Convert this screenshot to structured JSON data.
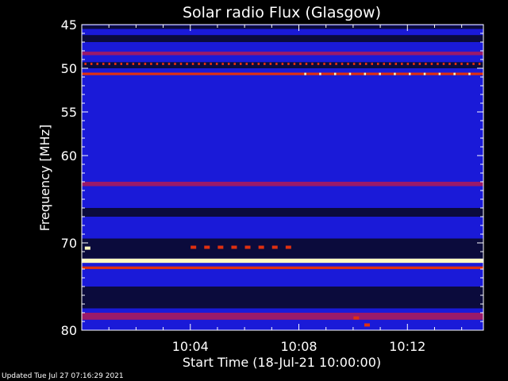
{
  "chart_data": {
    "type": "heatmap",
    "title": "Solar radio Flux (Glasgow)",
    "xlabel": "Start Time (18-Jul-21 10:00:00)",
    "ylabel": "Frequency [MHz]",
    "xlim_minutes": [
      0,
      14.8
    ],
    "ylim_mhz": [
      45,
      80
    ],
    "y_ticks": [
      {
        "value": 45,
        "label": "45"
      },
      {
        "value": 50,
        "label": "50"
      },
      {
        "value": 55,
        "label": "55"
      },
      {
        "value": 60,
        "label": "60"
      },
      {
        "value": 70,
        "label": "70"
      },
      {
        "value": 80,
        "label": "80"
      }
    ],
    "y_minor_ticks": [
      46,
      47,
      48,
      49,
      51,
      52,
      53,
      54,
      56,
      57,
      58,
      59,
      61,
      62,
      63,
      64,
      65,
      66,
      67,
      68,
      69,
      71,
      72,
      73,
      74,
      75,
      76,
      77,
      78,
      79
    ],
    "x_ticks": [
      {
        "value": 4,
        "label": "10:04"
      },
      {
        "value": 8,
        "label": "10:08"
      },
      {
        "value": 12,
        "label": "10:12"
      }
    ],
    "x_minor_ticks": [
      1,
      2,
      3,
      5,
      6,
      7,
      9,
      10,
      11,
      13,
      14
    ],
    "colors": {
      "background": "#0b0b3c",
      "low": "#1a1ad8",
      "mid": "#9a1a6a",
      "high": "#e03010",
      "peak": "#fff8c0"
    },
    "bands": [
      {
        "from": 45.1,
        "to": 45.5,
        "level": "dark"
      },
      {
        "from": 45.5,
        "to": 46.2,
        "level": "low"
      },
      {
        "from": 46.2,
        "to": 47.0,
        "level": "dark"
      },
      {
        "from": 47.0,
        "to": 48.1,
        "level": "low"
      },
      {
        "from": 48.1,
        "to": 48.5,
        "level": "mid"
      },
      {
        "from": 48.5,
        "to": 49.3,
        "level": "low"
      },
      {
        "from": 49.3,
        "to": 50.0,
        "level": "dark"
      },
      {
        "from": 50.0,
        "to": 50.5,
        "level": "low"
      },
      {
        "from": 50.5,
        "to": 50.8,
        "level": "high"
      },
      {
        "from": 50.8,
        "to": 52.0,
        "level": "low"
      },
      {
        "from": 52.0,
        "to": 55.0,
        "level": "low"
      },
      {
        "from": 55.0,
        "to": 59.0,
        "level": "low"
      },
      {
        "from": 59.0,
        "to": 63.0,
        "level": "low"
      },
      {
        "from": 63.0,
        "to": 63.5,
        "level": "mid"
      },
      {
        "from": 63.5,
        "to": 66.0,
        "level": "low"
      },
      {
        "from": 66.0,
        "to": 67.0,
        "level": "dark"
      },
      {
        "from": 67.0,
        "to": 69.5,
        "level": "low"
      },
      {
        "from": 69.5,
        "to": 71.8,
        "level": "dark"
      },
      {
        "from": 71.8,
        "to": 72.3,
        "level": "peak"
      },
      {
        "from": 72.3,
        "to": 72.7,
        "level": "low"
      },
      {
        "from": 72.7,
        "to": 73.0,
        "level": "high"
      },
      {
        "from": 73.0,
        "to": 75.0,
        "level": "low"
      },
      {
        "from": 75.0,
        "to": 77.5,
        "level": "dark"
      },
      {
        "from": 77.5,
        "to": 79.8,
        "level": "low"
      },
      {
        "from": 78.0,
        "to": 78.8,
        "level": "mid"
      }
    ],
    "dotted_bands": [
      {
        "freq": 49.5,
        "start": 0.1,
        "end": 14.8,
        "step": 0.22,
        "level": "high"
      },
      {
        "freq": 50.65,
        "start": 8.2,
        "end": 14.8,
        "step": 0.55,
        "level": "peak"
      }
    ],
    "bursts": [
      {
        "time": 0.2,
        "freq": 70.6,
        "level": "peak"
      },
      {
        "time": 4.1,
        "freq": 70.5,
        "level": "high"
      },
      {
        "time": 4.6,
        "freq": 70.5,
        "level": "high"
      },
      {
        "time": 5.1,
        "freq": 70.5,
        "level": "high"
      },
      {
        "time": 5.6,
        "freq": 70.5,
        "level": "high"
      },
      {
        "time": 6.1,
        "freq": 70.5,
        "level": "high"
      },
      {
        "time": 6.6,
        "freq": 70.5,
        "level": "high"
      },
      {
        "time": 7.1,
        "freq": 70.5,
        "level": "high"
      },
      {
        "time": 7.6,
        "freq": 70.5,
        "level": "high"
      },
      {
        "time": 10.1,
        "freq": 78.6,
        "level": "high"
      },
      {
        "time": 10.5,
        "freq": 79.4,
        "level": "high"
      }
    ]
  },
  "footer": {
    "updated": "Updated Tue Jul 27 07:16:29 2021"
  }
}
